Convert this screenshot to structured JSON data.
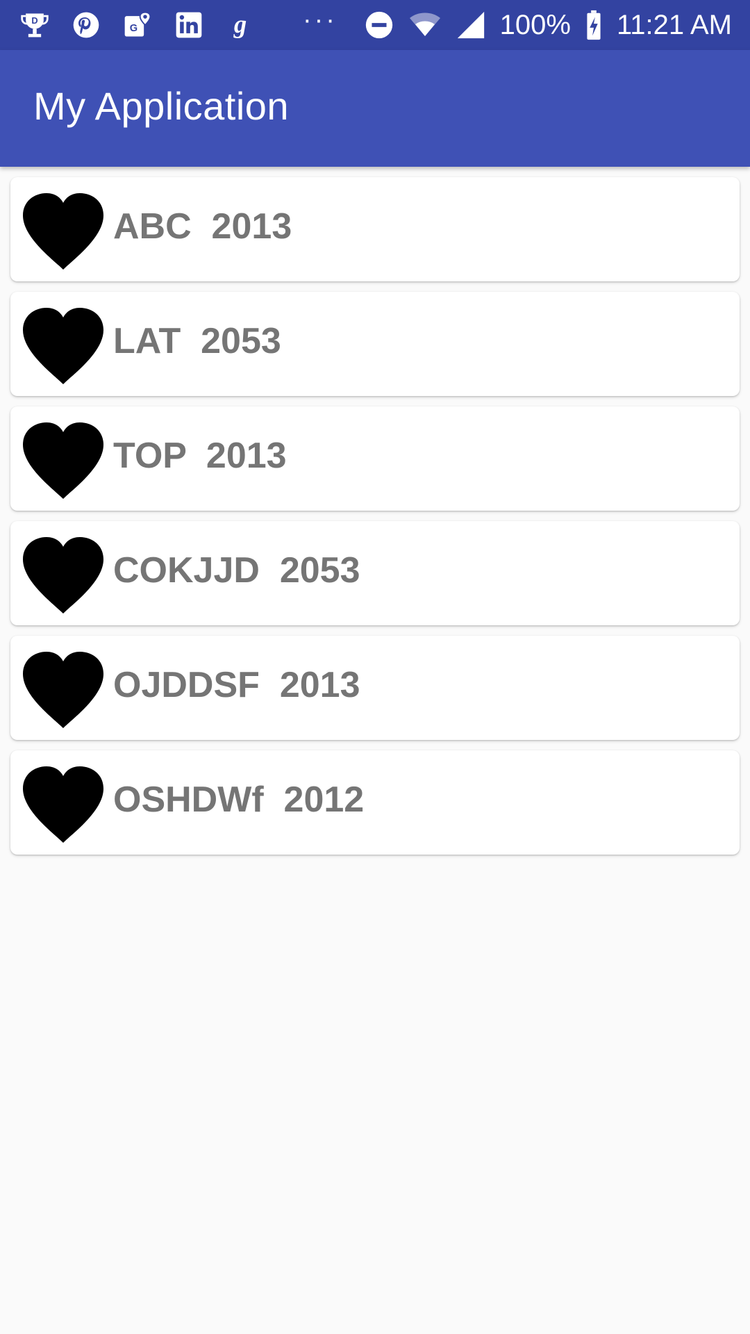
{
  "status_bar": {
    "left_icons": [
      "trophy-icon",
      "pinterest-icon",
      "maps-icon",
      "linkedin-icon",
      "goodreads-icon"
    ],
    "more": "···",
    "battery_percent": "100%",
    "time": "11:21 AM"
  },
  "app_bar": {
    "title": "My Application"
  },
  "list": {
    "items": [
      {
        "name": "ABC",
        "year": "2013",
        "label": "ABC  2013",
        "icon": "heart-icon"
      },
      {
        "name": "LAT",
        "year": "2053",
        "label": "LAT  2053",
        "icon": "heart-icon"
      },
      {
        "name": "TOP",
        "year": "2013",
        "label": "TOP  2013",
        "icon": "heart-icon"
      },
      {
        "name": "COKJJD",
        "year": "2053",
        "label": "COKJJD  2053",
        "icon": "heart-icon"
      },
      {
        "name": "OJDDSF",
        "year": "2013",
        "label": "OJDDSF  2013",
        "icon": "heart-icon"
      },
      {
        "name": "OSHDWf",
        "year": "2012",
        "label": "OSHDWf  2012",
        "icon": "heart-icon"
      }
    ]
  },
  "colors": {
    "status_bar": "#3343a1",
    "app_bar": "#3f51b5",
    "background": "#fafafa",
    "item_text": "#757575",
    "heart": "#000000"
  }
}
